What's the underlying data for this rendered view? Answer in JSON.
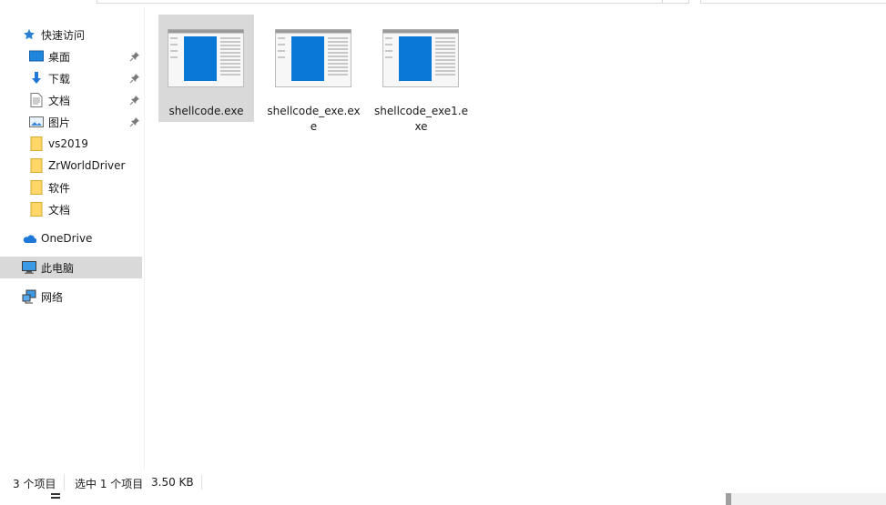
{
  "sidebar": {
    "quick_access": "快速访问",
    "items": [
      {
        "label": "桌面",
        "icon": "desktop-icon",
        "pinned": true
      },
      {
        "label": "下载",
        "icon": "download-icon",
        "pinned": true
      },
      {
        "label": "文档",
        "icon": "documents-icon",
        "pinned": true
      },
      {
        "label": "图片",
        "icon": "pictures-icon",
        "pinned": true
      },
      {
        "label": "vs2019",
        "icon": "folder-icon",
        "pinned": false
      },
      {
        "label": "ZrWorldDriver",
        "icon": "folder-icon",
        "pinned": false
      },
      {
        "label": "软件",
        "icon": "folder-icon",
        "pinned": false
      },
      {
        "label": "文档",
        "icon": "folder-icon",
        "pinned": false
      }
    ],
    "onedrive": "OneDrive",
    "this_pc": "此电脑",
    "network": "网络"
  },
  "files": [
    {
      "name": "shellcode.exe",
      "selected": true
    },
    {
      "name": "shellcode_exe.exe",
      "selected": false
    },
    {
      "name": "shellcode_exe1.exe",
      "selected": false
    }
  ],
  "status": {
    "item_count": "3 个项目",
    "selected": "选中 1 个项目",
    "size": "3.50 KB"
  },
  "colors": {
    "selection": "#d9d9d9",
    "folder": "#ffd766",
    "app_blue": "#0a78d7",
    "onedrive": "#1e78d7"
  }
}
